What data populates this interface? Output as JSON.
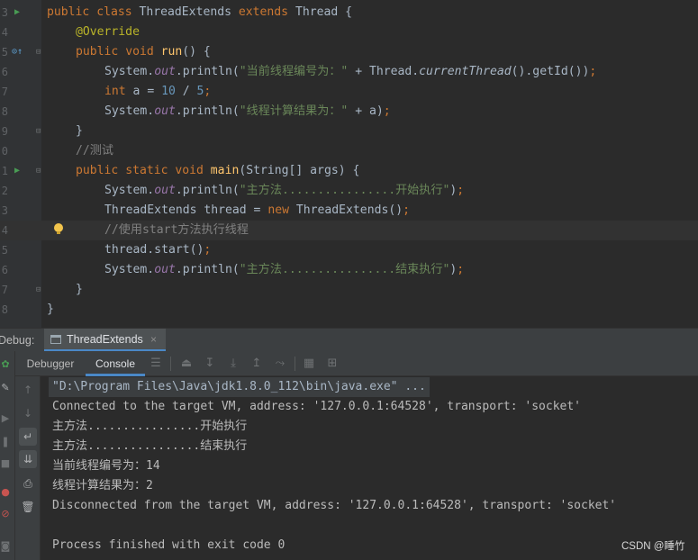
{
  "editor": {
    "lines": [
      {
        "ln": "3",
        "gutter": "run",
        "indent": 0,
        "tokens": [
          {
            "t": "public ",
            "c": "kw"
          },
          {
            "t": "class ",
            "c": "kw"
          },
          {
            "t": "ThreadExtends "
          },
          {
            "t": "extends ",
            "c": "kw"
          },
          {
            "t": "Thread {"
          }
        ]
      },
      {
        "ln": "4",
        "indent": 1,
        "tokens": [
          {
            "t": "@Override",
            "c": "ann"
          }
        ]
      },
      {
        "ln": "5",
        "gutter": "override",
        "fold": true,
        "indent": 1,
        "tokens": [
          {
            "t": "public ",
            "c": "kw"
          },
          {
            "t": "void ",
            "c": "kw"
          },
          {
            "t": "run",
            "c": "fn"
          },
          {
            "t": "() {"
          }
        ]
      },
      {
        "ln": "6",
        "indent": 2,
        "tokens": [
          {
            "t": "System."
          },
          {
            "t": "out",
            "c": "fld"
          },
          {
            "t": ".println("
          },
          {
            "t": "\"当前线程编号为：\"",
            "c": "str"
          },
          {
            "t": " + Thread."
          },
          {
            "t": "currentThread",
            "c": "it"
          },
          {
            "t": "().getId())"
          },
          {
            "t": ";",
            "c": "kw"
          }
        ]
      },
      {
        "ln": "7",
        "indent": 2,
        "tokens": [
          {
            "t": "int ",
            "c": "kw"
          },
          {
            "t": "a = "
          },
          {
            "t": "10",
            "c": "num"
          },
          {
            "t": " / "
          },
          {
            "t": "5",
            "c": "num"
          },
          {
            "t": ";",
            "c": "kw"
          }
        ]
      },
      {
        "ln": "8",
        "indent": 2,
        "tokens": [
          {
            "t": "System."
          },
          {
            "t": "out",
            "c": "fld"
          },
          {
            "t": ".println("
          },
          {
            "t": "\"线程计算结果为：\"",
            "c": "str"
          },
          {
            "t": " + a)"
          },
          {
            "t": ";",
            "c": "kw"
          }
        ]
      },
      {
        "ln": "9",
        "fold": true,
        "indent": 1,
        "tokens": [
          {
            "t": "}"
          }
        ]
      },
      {
        "ln": "0",
        "indent": 1,
        "tokens": [
          {
            "t": "//测试",
            "c": "cmt"
          }
        ]
      },
      {
        "ln": "1",
        "gutter": "run",
        "fold": true,
        "indent": 1,
        "tokens": [
          {
            "t": "public ",
            "c": "kw"
          },
          {
            "t": "static ",
            "c": "kw"
          },
          {
            "t": "void ",
            "c": "kw"
          },
          {
            "t": "main",
            "c": "fn"
          },
          {
            "t": "(String[] args) {"
          }
        ]
      },
      {
        "ln": "2",
        "indent": 2,
        "tokens": [
          {
            "t": "System."
          },
          {
            "t": "out",
            "c": "fld"
          },
          {
            "t": ".println("
          },
          {
            "t": "\"主方法................开始执行\"",
            "c": "str"
          },
          {
            "t": ")"
          },
          {
            "t": ";",
            "c": "kw"
          }
        ]
      },
      {
        "ln": "3",
        "indent": 2,
        "tokens": [
          {
            "t": "ThreadExtends thread = "
          },
          {
            "t": "new ",
            "c": "kw"
          },
          {
            "t": "ThreadExtends()"
          },
          {
            "t": ";",
            "c": "kw"
          }
        ]
      },
      {
        "ln": "4",
        "current": true,
        "bulb": true,
        "indent": 2,
        "tokens": [
          {
            "t": "//使用start方法执行线程",
            "c": "cmt"
          }
        ]
      },
      {
        "ln": "5",
        "indent": 2,
        "tokens": [
          {
            "t": "thread.start()"
          },
          {
            "t": ";",
            "c": "kw"
          }
        ]
      },
      {
        "ln": "6",
        "indent": 2,
        "tokens": [
          {
            "t": "System."
          },
          {
            "t": "out",
            "c": "fld"
          },
          {
            "t": ".println("
          },
          {
            "t": "\"主方法................结束执行\"",
            "c": "str"
          },
          {
            "t": ")"
          },
          {
            "t": ";",
            "c": "kw"
          }
        ]
      },
      {
        "ln": "7",
        "fold": true,
        "indent": 1,
        "tokens": [
          {
            "t": "}"
          }
        ]
      },
      {
        "ln": "8",
        "indent": 0,
        "tokens": [
          {
            "t": "}"
          }
        ]
      }
    ]
  },
  "debug": {
    "title": "Debug:",
    "run_tab": "ThreadExtends",
    "close": "×",
    "subtabs": [
      "Debugger",
      "Console"
    ],
    "active_subtab": "Console"
  },
  "console": {
    "lines": [
      "\"D:\\Program Files\\Java\\jdk1.8.0_112\\bin\\java.exe\" ...",
      "Connected to the target VM, address: '127.0.0.1:64528', transport: 'socket'",
      "主方法................开始执行",
      "主方法................结束执行",
      "当前线程编号为：14",
      "线程计算结果为：2",
      "Disconnected from the target VM, address: '127.0.0.1:64528', transport: 'socket'",
      "",
      "Process finished with exit code 0"
    ]
  },
  "watermark": "CSDN @睡竹",
  "colors": {
    "keyword": "#cc7832",
    "string": "#6a8759",
    "number": "#6897bb",
    "annotation": "#bbb529",
    "method": "#ffc66d",
    "field": "#9876aa",
    "comment": "#808080",
    "text": "#a9b7c6",
    "accent": "#4a88c7",
    "run": "#499c54"
  }
}
